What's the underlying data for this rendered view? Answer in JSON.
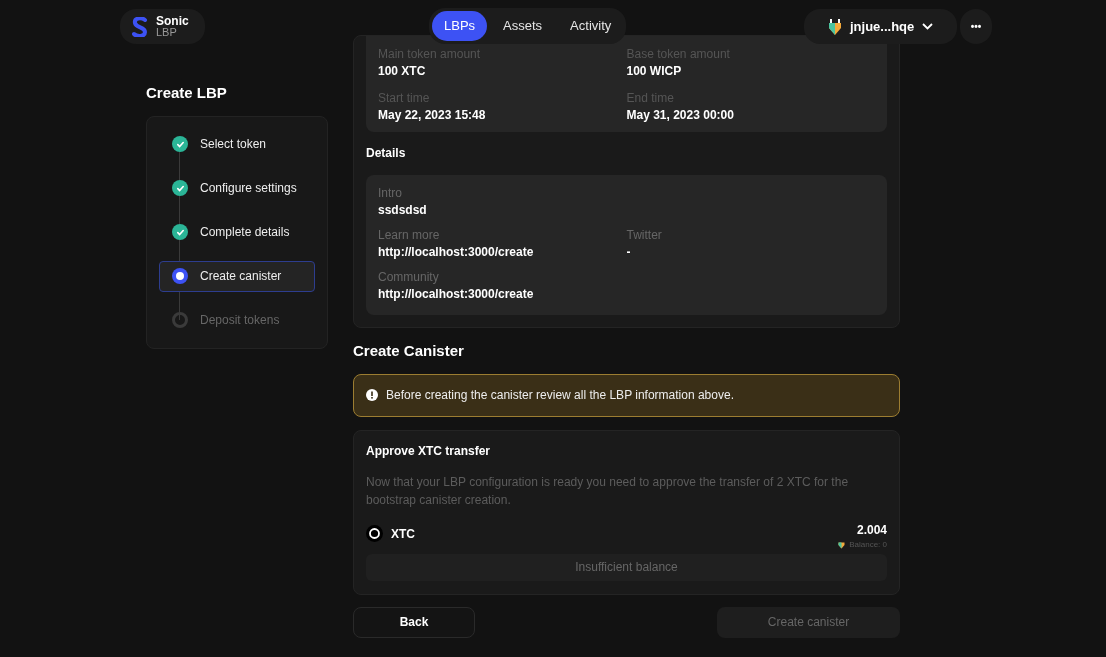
{
  "brand": {
    "name": "Sonic",
    "sub": "LBP"
  },
  "nav": [
    {
      "label": "LBPs",
      "selected": true
    },
    {
      "label": "Assets",
      "selected": false
    },
    {
      "label": "Activity",
      "selected": false
    }
  ],
  "wallet": {
    "address": "jnjue...hqe"
  },
  "menu_button": "•••",
  "page_title": "Create LBP",
  "steps": [
    {
      "label": "Select token",
      "kind": "done"
    },
    {
      "label": "Configure settings",
      "kind": "done"
    },
    {
      "label": "Complete details",
      "kind": "done"
    },
    {
      "label": "Create canister",
      "kind": "current"
    },
    {
      "label": "Deposit tokens",
      "kind": "pending"
    }
  ],
  "summary": [
    {
      "label": "Main token amount",
      "value": "100 XTC"
    },
    {
      "label": "Base token amount",
      "value": "100 WICP"
    },
    {
      "label": "Start time",
      "value": "May 22, 2023 15:48"
    },
    {
      "label": "End time",
      "value": "May 31, 2023 00:00"
    }
  ],
  "details": {
    "title": "Details",
    "rows": [
      [
        {
          "label": "Intro",
          "value": "ssdsdsd"
        }
      ],
      [
        {
          "label": "Learn more",
          "value": "http://localhost:3000/create"
        },
        {
          "label": "Twitter",
          "value": "-"
        }
      ],
      [
        {
          "label": "Community",
          "value": "http://localhost:3000/create"
        }
      ]
    ]
  },
  "create_canister": {
    "title": "Create Canister",
    "warning": "Before creating the canister review all the LBP information above.",
    "approve": {
      "title": "Approve XTC transfer",
      "description": "Now that your LBP configuration is ready you need to approve the transfer of 2 XTC for the bootstrap canister creation.",
      "token": "XTC",
      "amount": "2.004",
      "balance": "Balance: 0",
      "button": {
        "label": "Insufficient balance",
        "disabled": true
      }
    }
  },
  "footer": {
    "back": "Back",
    "create": {
      "label": "Create canister",
      "disabled": true
    }
  }
}
